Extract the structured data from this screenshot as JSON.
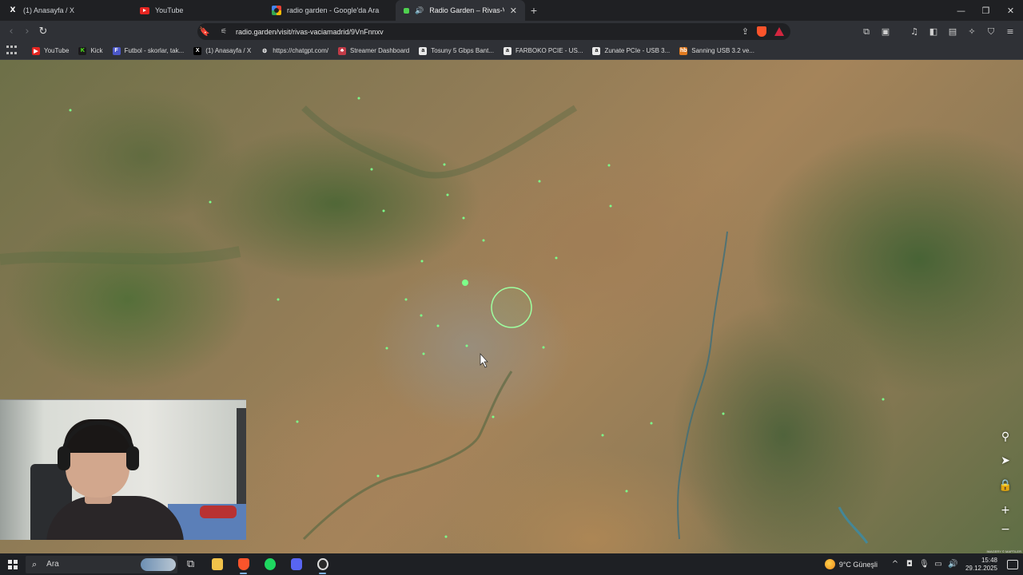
{
  "browser": {
    "tabs": [
      {
        "label": "(1) Anasayfa / X",
        "icon": "x-logo-icon"
      },
      {
        "label": "YouTube",
        "icon": "youtube-icon"
      },
      {
        "label": "radio garden - Google'da Ara",
        "icon": "google-icon"
      },
      {
        "label": "Radio Garden – Rivas-Vaciam",
        "icon": "playing-dot-icon",
        "active": true
      }
    ],
    "new_tab": "+",
    "window_controls": {
      "minimize": "—",
      "maximize": "❐",
      "close": "✕"
    },
    "address": {
      "url": "radio.garden/visit/rivas-vaciamadrid/9VnFnnxv"
    },
    "bookmarks": [
      {
        "label": "YouTube",
        "color": "#e52521",
        "glyph": "▶"
      },
      {
        "label": "Kick",
        "color": "#1b1b1b",
        "glyph": "K",
        "fg": "#53fc18"
      },
      {
        "label": "Futbol - skorlar, tak...",
        "color": "#4b57c8",
        "glyph": "F"
      },
      {
        "label": "(1) Anasayfa / X",
        "color": "#000000",
        "glyph": "X"
      },
      {
        "label": "https://chatgpt.com/",
        "color": "#2f3136",
        "glyph": "⚙"
      },
      {
        "label": "Streamer Dashboard",
        "color": "#c23b47",
        "glyph": "♣"
      },
      {
        "label": "Tosuny 5 Gbps Bant...",
        "color": "#e9e9e9",
        "glyph": "a",
        "fg": "#111"
      },
      {
        "label": "FARBOKO PCIE - US...",
        "color": "#e9e9e9",
        "glyph": "a",
        "fg": "#111"
      },
      {
        "label": "Zunate PCIe - USB 3...",
        "color": "#e9e9e9",
        "glyph": "a",
        "fg": "#111"
      },
      {
        "label": "Sanning USB 3.2 ve...",
        "color": "#e07a1f",
        "glyph": "hb"
      }
    ]
  },
  "map": {
    "selected_station": "rivas-vaciamadrid",
    "controls": [
      "map-pin-icon",
      "locate-arrow-icon",
      "lock-icon",
      "zoom-in-icon",
      "zoom-out-icon"
    ],
    "attribution": "IMAGERY © MAPTILER",
    "station_color": "#7dff8a"
  },
  "taskbar": {
    "search_placeholder": "Ara",
    "weather": "9°C  Güneşli",
    "time": "15:48",
    "date": "29.12.2025"
  }
}
